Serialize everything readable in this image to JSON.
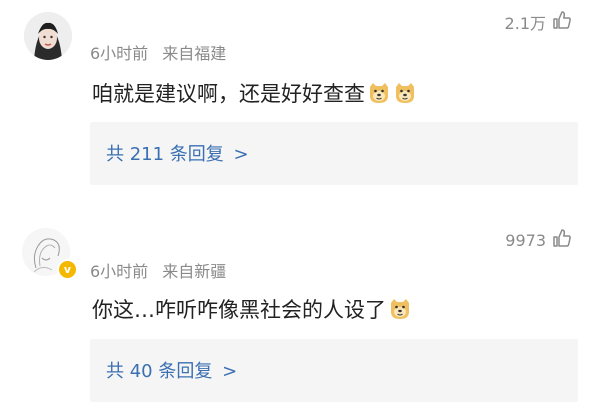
{
  "comments": [
    {
      "time": "6小时前",
      "source": "来自福建",
      "likes": "2.1万",
      "text": "咱就是建议啊，还是好好查查",
      "reply_label": "共 211 条回复",
      "reply_chevron": ">",
      "emojis": [
        "doge-emoji",
        "doge-emoji"
      ]
    },
    {
      "time": "6小时前",
      "source": "来自新疆",
      "likes": "9973",
      "text": "你这…咋听咋像黑社会的人设了",
      "reply_label": "共 40 条回复",
      "reply_chevron": ">",
      "emojis": [
        "doge-emoji"
      ],
      "badge": "v"
    }
  ]
}
